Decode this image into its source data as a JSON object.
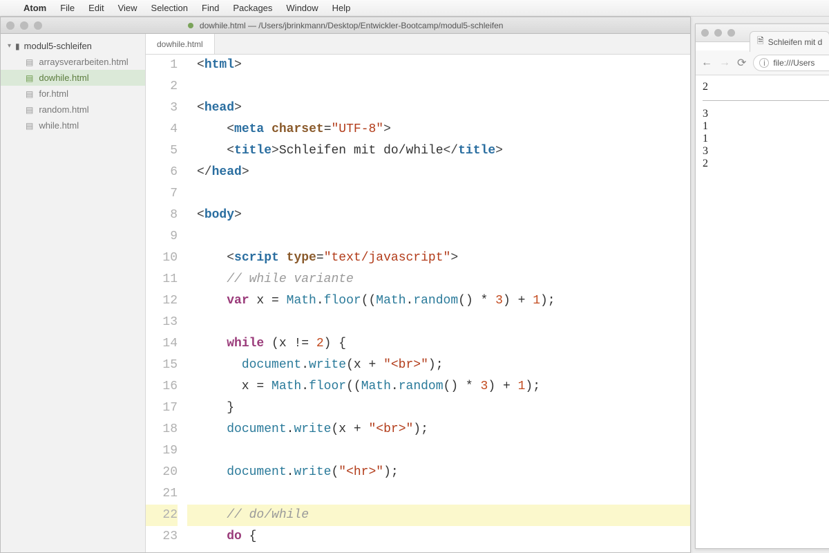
{
  "menubar": {
    "appname": "Atom",
    "items": [
      "File",
      "Edit",
      "View",
      "Selection",
      "Find",
      "Packages",
      "Window",
      "Help"
    ]
  },
  "atom": {
    "title": "dowhile.html — /Users/jbrinkmann/Desktop/Entwickler-Bootcamp/modul5-schleifen",
    "sidebar": {
      "root": "modul5-schleifen",
      "files": [
        {
          "name": "arraysverarbeiten.html",
          "active": false
        },
        {
          "name": "dowhile.html",
          "active": true
        },
        {
          "name": "for.html",
          "active": false
        },
        {
          "name": "random.html",
          "active": false
        },
        {
          "name": "while.html",
          "active": false
        }
      ]
    },
    "tab": "dowhile.html",
    "code": {
      "current_line": 22,
      "lines": [
        {
          "n": 1,
          "t": "<html>",
          "kind": "tag"
        },
        {
          "n": 2,
          "t": "",
          "kind": "blank"
        },
        {
          "n": 3,
          "t": "<head>",
          "kind": "tag"
        },
        {
          "n": 4,
          "t": "    <meta charset=\"UTF-8\">",
          "kind": "metatag"
        },
        {
          "n": 5,
          "t": "    <title>Schleifen mit do/while</title>",
          "kind": "titletag"
        },
        {
          "n": 6,
          "t": "</head>",
          "kind": "tag"
        },
        {
          "n": 7,
          "t": "",
          "kind": "blank"
        },
        {
          "n": 8,
          "t": "<body>",
          "kind": "tag"
        },
        {
          "n": 9,
          "t": "",
          "kind": "blank"
        },
        {
          "n": 10,
          "t": "    <script type=\"text/javascript\">",
          "kind": "scripttag"
        },
        {
          "n": 11,
          "t": "    // while variante",
          "kind": "comment"
        },
        {
          "n": 12,
          "t": "    var x = Math.floor((Math.random() * 3) + 1);",
          "kind": "js1"
        },
        {
          "n": 13,
          "t": "",
          "kind": "blank"
        },
        {
          "n": 14,
          "t": "    while (x != 2) {",
          "kind": "js_while"
        },
        {
          "n": 15,
          "t": "      document.write(x + \"<br>\");",
          "kind": "js_write_br"
        },
        {
          "n": 16,
          "t": "      x = Math.floor((Math.random() * 3) + 1);",
          "kind": "js_assign"
        },
        {
          "n": 17,
          "t": "    }",
          "kind": "js_brace"
        },
        {
          "n": 18,
          "t": "    document.write(x + \"<br>\");",
          "kind": "js_write_br2"
        },
        {
          "n": 19,
          "t": "",
          "kind": "blank"
        },
        {
          "n": 20,
          "t": "    document.write(\"<hr>\");",
          "kind": "js_write_hr"
        },
        {
          "n": 21,
          "t": "",
          "kind": "blank"
        },
        {
          "n": 22,
          "t": "    // do/while",
          "kind": "comment"
        },
        {
          "n": 23,
          "t": "    do {",
          "kind": "js_do"
        }
      ]
    }
  },
  "browser": {
    "tab_title": "Schleifen mit d",
    "url": "file:///Users",
    "output_top": "2",
    "output_lines": [
      "3",
      "1",
      "1",
      "3",
      "2"
    ]
  }
}
